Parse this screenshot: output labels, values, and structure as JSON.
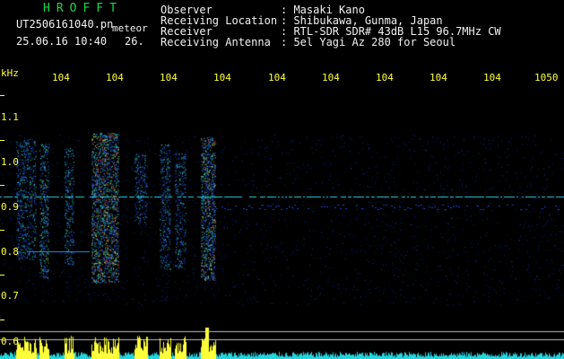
{
  "header": {
    "app_title": "HROFFT",
    "filename": "UT2506161040.pn",
    "meteor_label": "meteor",
    "datetime": "25.06.16 10:40",
    "row_value": "26."
  },
  "info": [
    {
      "label": "Observer",
      "value": ": Masaki Kano"
    },
    {
      "label": "Receiving Location",
      "value": ": Shibukawa, Gunma, Japan"
    },
    {
      "label": "Receiver",
      "value": ": RTL-SDR SDR# 43dB L15 96.7MHz CW"
    },
    {
      "label": "Receiving Antenna",
      "value": ": 5el Yagi Az 280 for Seoul"
    }
  ],
  "axis": {
    "y_unit": "kHz",
    "x_ticks": [
      "104",
      "104",
      "104",
      "104",
      "104",
      "104",
      "104",
      "104",
      "104",
      "1050"
    ],
    "y_ticks": [
      "1.1",
      "1.0",
      "0.9",
      "0.8",
      "0.7",
      "0.6"
    ]
  },
  "colors": {
    "text_green": "#19d84a",
    "text_white": "#f2f2f2",
    "axis_yellow": "#ffff3a",
    "background": "#000000"
  }
}
